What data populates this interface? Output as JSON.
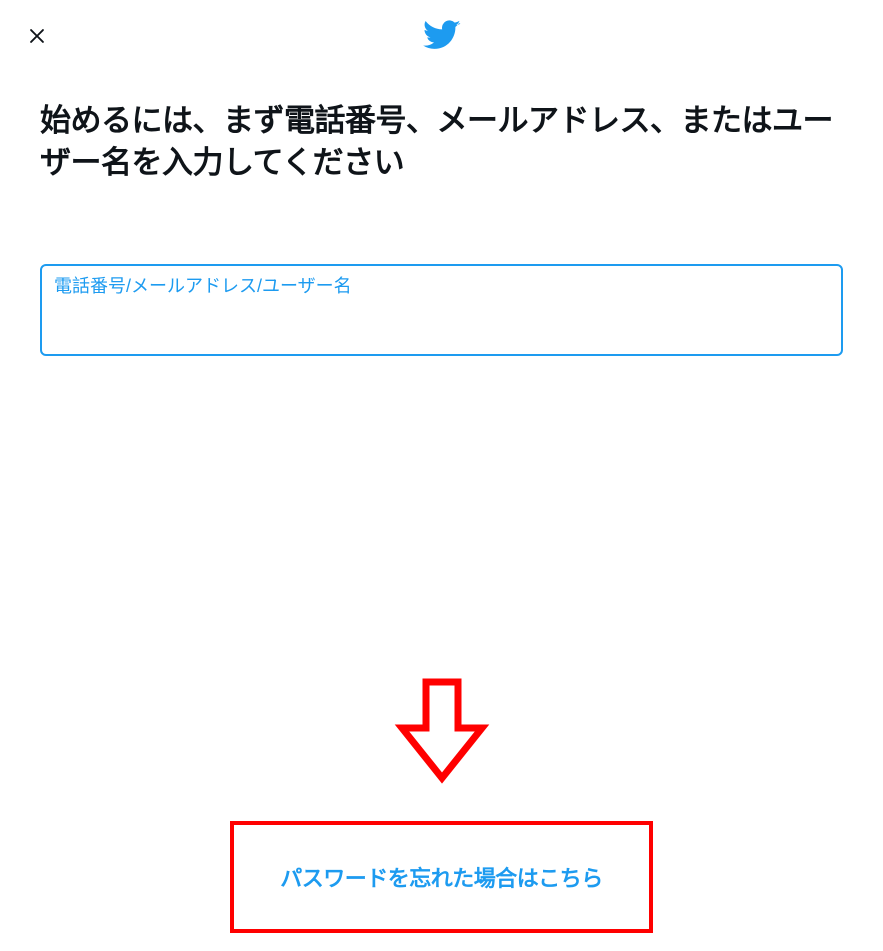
{
  "header": {
    "close_label": "Close",
    "logo_label": "Twitter"
  },
  "main": {
    "heading": "始めるには、まず電話番号、メールアドレス、またはユーザー名を入力してください",
    "input": {
      "label": "電話番号/メールアドレス/ユーザー名",
      "value": ""
    }
  },
  "footer": {
    "forgot_password_label": "パスワードを忘れた場合はこちら"
  },
  "colors": {
    "accent": "#1d9bf0",
    "annotation": "#ff0000",
    "text": "#0f1419"
  }
}
